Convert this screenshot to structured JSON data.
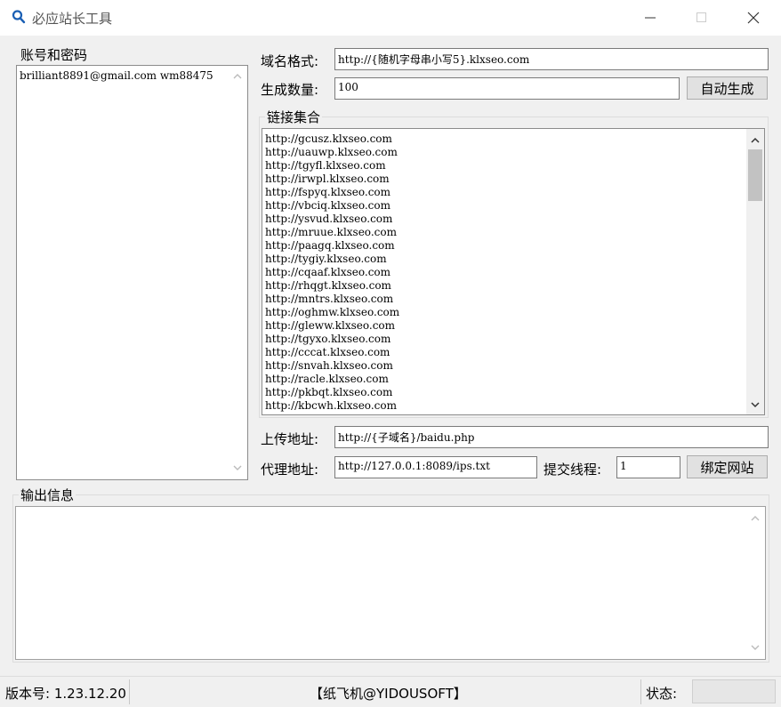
{
  "window": {
    "title": "必应站长工具",
    "icons": {
      "app": "search-icon",
      "minimize": "minimize-icon",
      "maximize": "maximize-icon",
      "close": "close-icon"
    }
  },
  "accounts": {
    "label": "账号和密码",
    "items": [
      "brilliant8891@gmail.com wm88475"
    ]
  },
  "domain_format": {
    "label": "域名格式:",
    "value": "http://{随机字母串小写5}.klxseo.com"
  },
  "count": {
    "label": "生成数量:",
    "value": "100",
    "button": "自动生成"
  },
  "links": {
    "label": "链接集合",
    "items": [
      "http://gcusz.klxseo.com",
      "http://uauwp.klxseo.com",
      "http://tgyfl.klxseo.com",
      "http://irwpl.klxseo.com",
      "http://fspyq.klxseo.com",
      "http://vbciq.klxseo.com",
      "http://ysvud.klxseo.com",
      "http://mruue.klxseo.com",
      "http://paagq.klxseo.com",
      "http://tygiy.klxseo.com",
      "http://cqaaf.klxseo.com",
      "http://rhqgt.klxseo.com",
      "http://mntrs.klxseo.com",
      "http://oghmw.klxseo.com",
      "http://gleww.klxseo.com",
      "http://tgyxo.klxseo.com",
      "http://cccat.klxseo.com",
      "http://snvah.klxseo.com",
      "http://racle.klxseo.com",
      "http://pkbqt.klxseo.com",
      "http://kbcwh.klxseo.com"
    ]
  },
  "upload": {
    "label": "上传地址:",
    "value": "http://{子域名}/baidu.php"
  },
  "proxy": {
    "label": "代理地址:",
    "value": "http://127.0.0.1:8089/ips.txt"
  },
  "threads": {
    "label": "提交线程:",
    "value": "1",
    "button": "绑定网站"
  },
  "output": {
    "label": "输出信息"
  },
  "statusbar": {
    "version": "版本号: 1.23.12.20",
    "brand": "【纸飞机@YIDOUSOFT】",
    "status_label": "状态:"
  }
}
